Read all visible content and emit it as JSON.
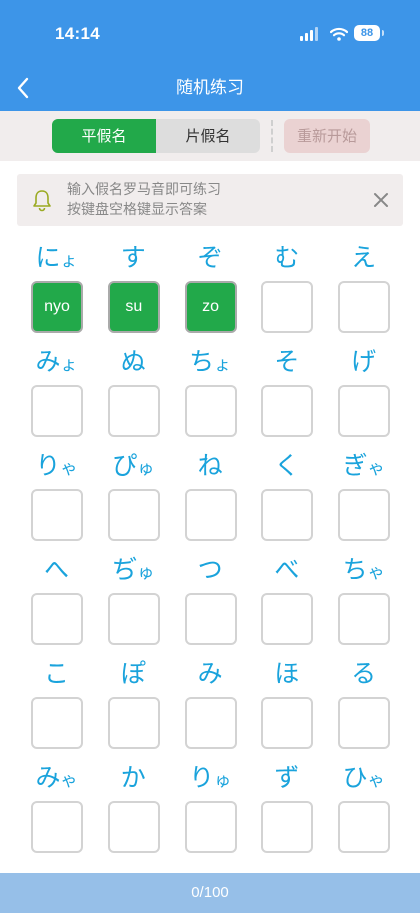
{
  "status": {
    "time": "14:14",
    "battery": "88"
  },
  "nav": {
    "title": "随机练习",
    "back_icon": "chevron-left-icon"
  },
  "mode": {
    "tabs": [
      {
        "label": "平假名",
        "active": true
      },
      {
        "label": "片假名",
        "active": false
      }
    ],
    "restart_label": "重新开始"
  },
  "tip": {
    "line1": "输入假名罗马音即可练习",
    "line2": "按键盘空格键显示答案",
    "icon": "bell-icon",
    "close_icon": "close-icon"
  },
  "colors": {
    "header": "#3d95e8",
    "accent": "#22a94a",
    "kana": "#1aa3dc",
    "footer": "#96bfe8"
  },
  "grid": [
    [
      {
        "kana": "にょ",
        "answer": "nyo"
      },
      {
        "kana": "す",
        "answer": "su"
      },
      {
        "kana": "ぞ",
        "answer": "zo"
      },
      {
        "kana": "む",
        "answer": ""
      },
      {
        "kana": "え",
        "answer": ""
      }
    ],
    [
      {
        "kana": "みょ",
        "answer": ""
      },
      {
        "kana": "ぬ",
        "answer": ""
      },
      {
        "kana": "ちょ",
        "answer": ""
      },
      {
        "kana": "そ",
        "answer": ""
      },
      {
        "kana": "げ",
        "answer": ""
      }
    ],
    [
      {
        "kana": "りゃ",
        "answer": ""
      },
      {
        "kana": "ぴゅ",
        "answer": ""
      },
      {
        "kana": "ね",
        "answer": ""
      },
      {
        "kana": "く",
        "answer": ""
      },
      {
        "kana": "ぎゃ",
        "answer": ""
      }
    ],
    [
      {
        "kana": "へ",
        "answer": ""
      },
      {
        "kana": "ぢゅ",
        "answer": ""
      },
      {
        "kana": "つ",
        "answer": ""
      },
      {
        "kana": "べ",
        "answer": ""
      },
      {
        "kana": "ちゃ",
        "answer": ""
      }
    ],
    [
      {
        "kana": "こ",
        "answer": ""
      },
      {
        "kana": "ぽ",
        "answer": ""
      },
      {
        "kana": "み",
        "answer": ""
      },
      {
        "kana": "ほ",
        "answer": ""
      },
      {
        "kana": "る",
        "answer": ""
      }
    ],
    [
      {
        "kana": "みゃ",
        "answer": ""
      },
      {
        "kana": "か",
        "answer": ""
      },
      {
        "kana": "りゅ",
        "answer": ""
      },
      {
        "kana": "ず",
        "answer": ""
      },
      {
        "kana": "ひゃ",
        "answer": ""
      }
    ]
  ],
  "footer": {
    "progress": "0/100"
  }
}
